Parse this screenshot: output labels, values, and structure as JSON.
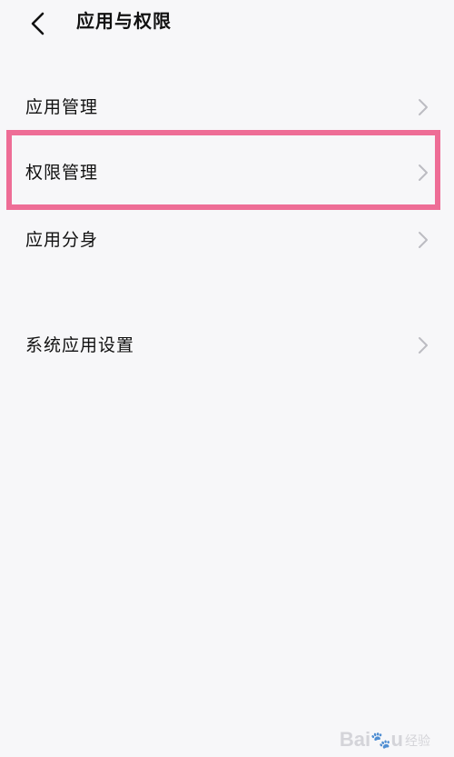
{
  "header": {
    "title": "应用与权限",
    "back_icon": "chevron-left-icon"
  },
  "menu": {
    "items": [
      {
        "label": "应用管理",
        "icon": "chevron-right-icon"
      },
      {
        "label": "权限管理",
        "icon": "chevron-right-icon",
        "highlighted": true
      },
      {
        "label": "应用分身",
        "icon": "chevron-right-icon"
      },
      {
        "label": "系统应用设置",
        "icon": "chevron-right-icon"
      }
    ]
  },
  "colors": {
    "background": "#f7f7f9",
    "highlight": "#ee6d96",
    "chevron": "#bcbcc2",
    "text": "#111111"
  },
  "watermark": {
    "brand": "Bai",
    "brand_end": "u",
    "sub": "经验"
  }
}
